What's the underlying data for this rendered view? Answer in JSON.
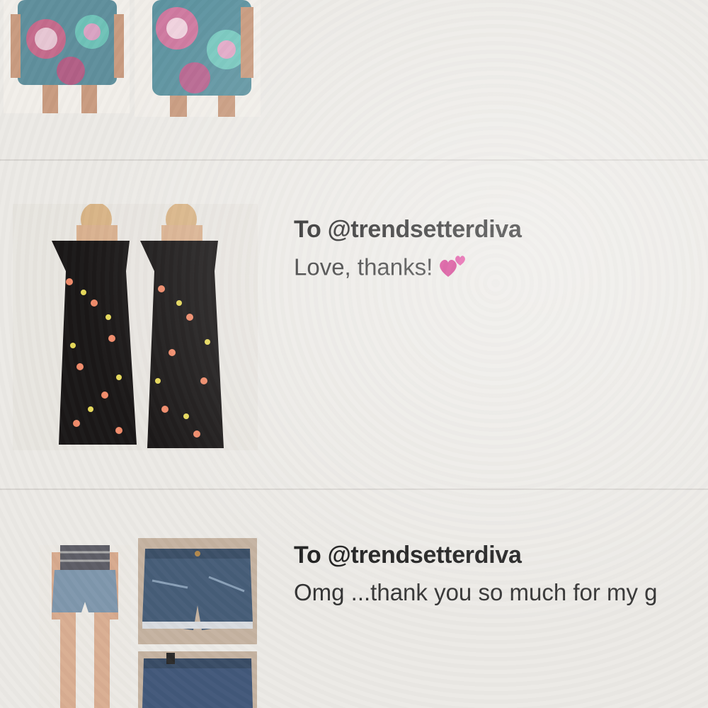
{
  "feed": {
    "comments": [
      {
        "to_prefix": "To",
        "username": "@trendsetterdiva",
        "message": "Love, thanks!",
        "emoji": "two-hearts-icon"
      },
      {
        "to_prefix": "To",
        "username": "@trendsetterdiva",
        "message": "Omg ...thank you so much for my g"
      }
    ]
  },
  "colors": {
    "background": "#eceae6",
    "divider": "#d6d3cf",
    "text": "#1e1e1e",
    "heart": "#d2338a"
  }
}
